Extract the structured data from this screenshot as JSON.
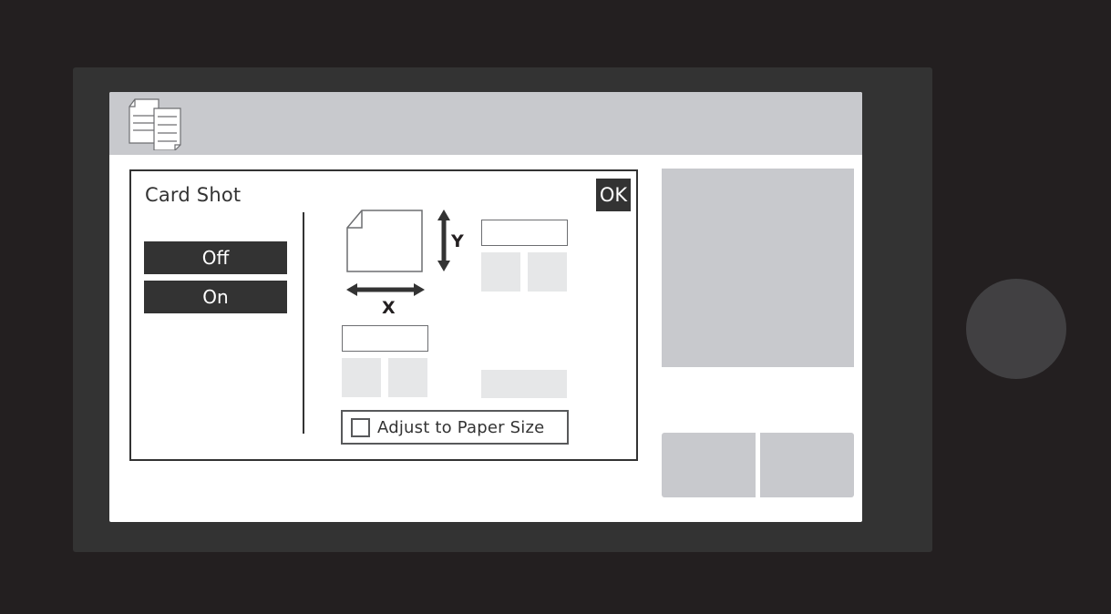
{
  "header": {
    "icon": "copy-documents-icon"
  },
  "dialog": {
    "title": "Card Shot",
    "ok_label": "OK",
    "options": [
      {
        "label": "Off"
      },
      {
        "label": "On"
      }
    ],
    "diagram": {
      "icon": "paper-corner-icon",
      "y_label": "Y",
      "x_label": "X"
    },
    "y_size": {
      "value": "",
      "decrease_icon": "blank",
      "increase_icon": "blank"
    },
    "x_size": {
      "value": "",
      "decrease_icon": "blank",
      "increase_icon": "blank"
    },
    "adjust_checkbox": {
      "label": "Adjust to Paper Size",
      "checked": false
    }
  },
  "colors": {
    "dark": "#333333",
    "panel_gray": "#c8c9cd",
    "light_gray": "#e6e7e8",
    "background": "#231f20"
  }
}
